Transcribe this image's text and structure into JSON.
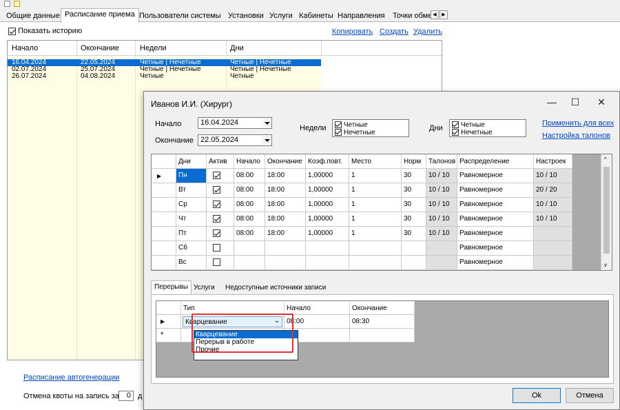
{
  "main_tabs": [
    "Общие данные",
    "Расписание приема",
    "Пользователи системы",
    "Установки",
    "Услуги",
    "Кабинеты",
    "Направления",
    "Точки обме"
  ],
  "history": {
    "show_history_label": "Показать историю",
    "copy": "Копировать",
    "create": "Создать",
    "delete": "Удалить",
    "columns": [
      "Начало",
      "Окончание",
      "Недели",
      "Дни"
    ],
    "rows": [
      {
        "start": "16.04.2024",
        "end": "22.05.2024",
        "weeks": "Четные | Нечетные",
        "days": "Четные | Нечетные"
      },
      {
        "start": "02.07.2024",
        "end": "25.07.2024",
        "weeks": "Четные | Нечетные",
        "days": "Четные | Нечетные"
      },
      {
        "start": "26.07.2024",
        "end": "04.08.2024",
        "weeks": "Четные",
        "days": "Четные"
      }
    ]
  },
  "bottom": {
    "autogen_link": "Расписание автогенерации",
    "quota_label": "Отмена квоты на запись за",
    "quota_value": "0",
    "quota_suffix": "д"
  },
  "dialog": {
    "title": "Иванов И.И. (Хирург)",
    "start_label": "Начало",
    "start_value": "16.04.2024",
    "end_label": "Окончание",
    "end_value": "22.05.2024",
    "weeks_label": "Недели",
    "weeks_even": "Четные",
    "weeks_odd": "Нечетные",
    "days_label": "Дни",
    "days_even": "Четные",
    "days_odd": "Нечетные",
    "apply_all": "Применить для всех",
    "ticket_settings": "Настройка талонов",
    "grid_columns": [
      "Дни",
      "Актив",
      "Начало",
      "Окончание",
      "Коэф.повт.",
      "Место",
      "Норм",
      "Талонов",
      "Распределение",
      "Настроек"
    ],
    "grid_rows": [
      {
        "day": "Пн",
        "active": true,
        "start": "08:00",
        "end": "18:00",
        "coef": "1,00000",
        "place": "1",
        "norm": "30",
        "tickets": "10 / 10",
        "dist": "Равномерное",
        "settings": "10 / 10"
      },
      {
        "day": "Вт",
        "active": true,
        "start": "08:00",
        "end": "18:00",
        "coef": "1,00000",
        "place": "1",
        "norm": "30",
        "tickets": "10 / 10",
        "dist": "Равномерное",
        "settings": "20 / 20"
      },
      {
        "day": "Ср",
        "active": true,
        "start": "08:00",
        "end": "18:00",
        "coef": "1,00000",
        "place": "1",
        "norm": "30",
        "tickets": "10 / 10",
        "dist": "Равномерное",
        "settings": "10 / 10"
      },
      {
        "day": "Чт",
        "active": true,
        "start": "08:00",
        "end": "18:00",
        "coef": "1,00000",
        "place": "1",
        "norm": "30",
        "tickets": "10 / 10",
        "dist": "Равномерное",
        "settings": "10 / 10"
      },
      {
        "day": "Пт",
        "active": true,
        "start": "08:00",
        "end": "18:00",
        "coef": "1,00000",
        "place": "1",
        "norm": "30",
        "tickets": "10 / 10",
        "dist": "Равномерное",
        "settings": ""
      },
      {
        "day": "Сб",
        "active": false,
        "start": "",
        "end": "",
        "coef": "",
        "place": "",
        "norm": "",
        "tickets": "",
        "dist": "Равномерное",
        "settings": ""
      },
      {
        "day": "Вс",
        "active": false,
        "start": "",
        "end": "",
        "coef": "",
        "place": "",
        "norm": "",
        "tickets": "",
        "dist": "Равномерное",
        "settings": ""
      }
    ],
    "lower_tabs": [
      "Перерывы",
      "Услуги",
      "Недоступные источники записи"
    ],
    "break_columns": [
      "Тип",
      "Начало",
      "Окончание"
    ],
    "break_row": {
      "type": "Кварцевание",
      "start": "08:00",
      "end": "08:30"
    },
    "break_options": [
      "Кварцевание",
      "Перерыв в работе",
      "Прочие"
    ],
    "ok": "Ok",
    "cancel": "Отмена"
  },
  "colors": {
    "selection": "#0a6bd1",
    "link": "#0044cc",
    "highlight": "#dd3333",
    "history_bg": "#fffde6"
  }
}
